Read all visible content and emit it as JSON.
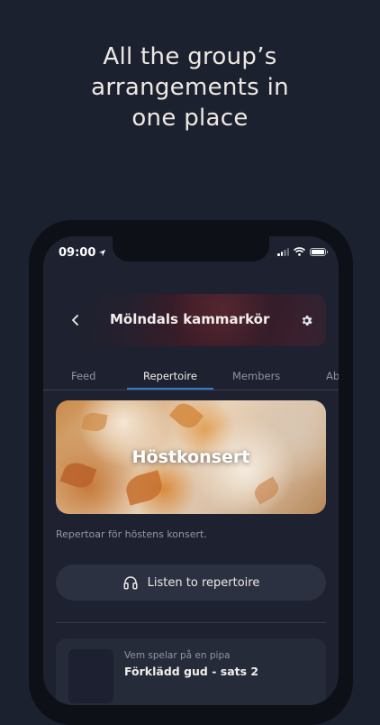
{
  "headline": {
    "line1": "All the group’s",
    "line2": "arrangements in",
    "line3": "one place"
  },
  "status_bar": {
    "time": "09:00",
    "icons": [
      "location-arrow-icon",
      "signal-icon",
      "wifi-icon",
      "battery-icon"
    ]
  },
  "group": {
    "name": "Mölndals kammarkör",
    "icons": [
      "chevron-left-icon",
      "gear-icon"
    ]
  },
  "tabs": [
    {
      "label": "Feed",
      "active": false
    },
    {
      "label": "Repertoire",
      "active": true
    },
    {
      "label": "Members",
      "active": false
    },
    {
      "label": "Ab",
      "active": false
    }
  ],
  "banner": {
    "title": "Höstkonsert"
  },
  "description": "Repertoar för höstens konsert.",
  "listen_button": {
    "label": "Listen to repertoire",
    "icon": "headphones-icon"
  },
  "songs": [
    {
      "subtitle": "Vem spelar på en pipa",
      "title": "Förklädd gud - sats 2"
    }
  ],
  "colors": {
    "background": "#1c2130",
    "accent_tab": "#3a78c9",
    "button_bg": "#2c3142"
  }
}
